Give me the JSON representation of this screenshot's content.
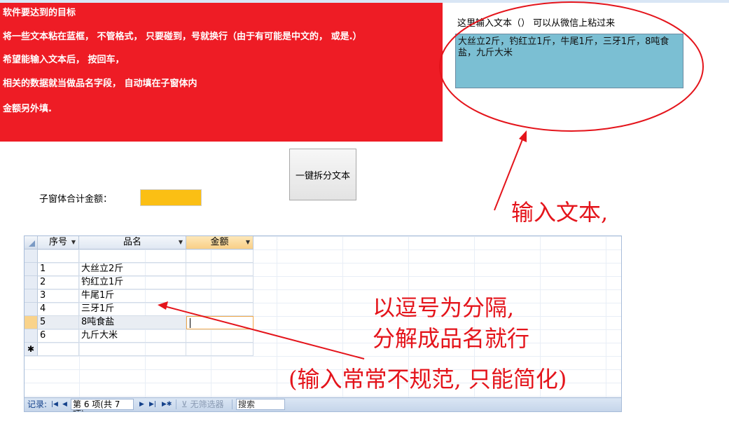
{
  "notes": {
    "lines": [
      "软件要达到的目标",
      "将一些文本粘在蓝框， 不管格式， 只要碰到，号就换行（由于有可能是中文的， 或是.）",
      "希望能输入文本后， 按回车，",
      "相关的数据就当做品名字段， 自动填在子窗体内",
      "金额另外填."
    ],
    "background": "#ee1c25"
  },
  "input": {
    "label": "这里输入文本（） 可以从微信上粘过来",
    "text": "大丝立2斤，钓红立1斤，牛尾1斤，三牙1斤，8吨食盐，九斤大米",
    "background": "#7bbfd3"
  },
  "split_button": {
    "label": "一键拆分文本"
  },
  "subform_total": {
    "label": "子窗体合计金额：",
    "value": "",
    "background": "#fbbf14"
  },
  "datasheet": {
    "columns": [
      "序号",
      "品名",
      "金额"
    ],
    "rows": [
      {
        "no": "",
        "name": "",
        "amount": ""
      },
      {
        "no": "1",
        "name": "大丝立2斤",
        "amount": ""
      },
      {
        "no": "2",
        "name": "钓红立1斤",
        "amount": ""
      },
      {
        "no": "3",
        "name": "牛尾1斤",
        "amount": ""
      },
      {
        "no": "4",
        "name": "三牙1斤",
        "amount": ""
      },
      {
        "no": "5",
        "name": "8吨食盐",
        "amount": ""
      },
      {
        "no": "6",
        "name": "九斤大米",
        "amount": ""
      }
    ],
    "new_row_marker": "✱",
    "current_row": 5
  },
  "record_nav": {
    "label": "记录:",
    "position": "第 6 项(共 7 项)",
    "filter": "无筛选器",
    "search": "搜索"
  },
  "annotations": {
    "input_text": "输入文本,",
    "split_line1": "以逗号为分隔,",
    "split_line2": "分解成品名就行",
    "simplify": "(输入常常不规范, 只能简化)",
    "color": "#e4141b"
  }
}
